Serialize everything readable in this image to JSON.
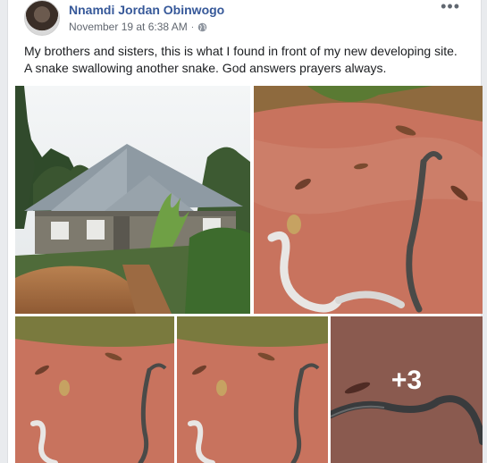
{
  "post": {
    "author": "Nnamdi Jordan Obinwogo",
    "timestamp": "November 19 at 6:38 AM",
    "separator": "·",
    "privacy_icon": "globe-icon",
    "more_icon": "more-options-icon",
    "text_line1": "My brothers and sisters, this is what I found in front of my new developing site.",
    "text_line2": "A snake swallowing another snake. God answers prayers always."
  },
  "gallery": {
    "photos": [
      {
        "subject": "house-photo"
      },
      {
        "subject": "snakes-on-red-soil-photo"
      },
      {
        "subject": "snakes-on-red-soil-photo"
      },
      {
        "subject": "snakes-on-red-soil-photo"
      },
      {
        "subject": "snake-closeup-photo"
      }
    ],
    "more_count_label": "+3"
  },
  "colors": {
    "author_link": "#365899",
    "meta_text": "#616770",
    "body_text": "#1c1e21",
    "soil": "#c2705b"
  }
}
